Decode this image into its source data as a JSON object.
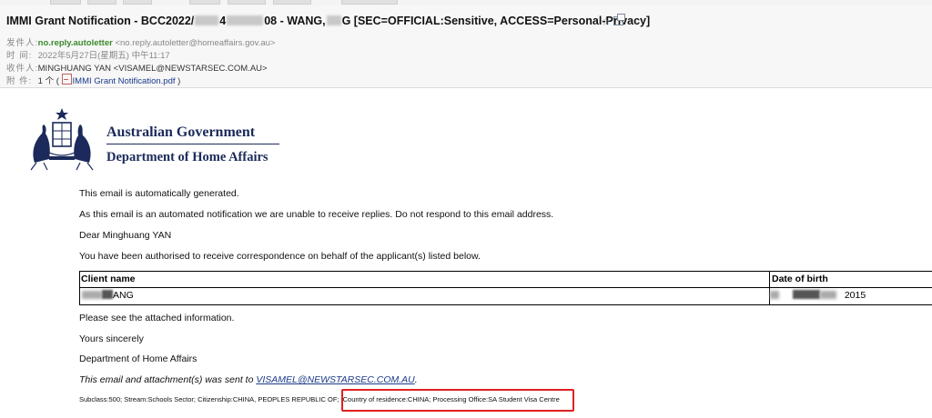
{
  "email": {
    "subject_start": "IMMI Grant Notification - BCC2022/",
    "subject_mid": "4",
    "subject_ref_end": "08 - WANG,",
    "subject_end": "G [SEC=OFFICIAL:Sensitive, ACCESS=Personal-Privacy]",
    "from_label": "发件人:",
    "from_name": "no.reply.autoletter",
    "from_address": "<no.reply.autoletter@homeaffairs.gov.au>",
    "time_label": "时 间:",
    "time_value": "2022年5月27日(星期五) 中午11:17",
    "to_label": "收件人:",
    "to_value": "MINGHUANG YAN <VISAMEL@NEWSTARSEC.COM.AU>",
    "attach_label": "附 件:",
    "attach_count_prefix": "1 个 (",
    "attach_file": "IMMI Grant Notification.pdf",
    "attach_count_suffix": ")"
  },
  "letterhead": {
    "gov_name": "Australian Government",
    "dept_name": "Department of Home Affairs"
  },
  "body": {
    "auto_generated": "This email is automatically generated.",
    "no_reply": "As this email is an automated notification we are unable to receive replies. Do not respond to this email address.",
    "salutation": "Dear Minghuang YAN",
    "authorised": "You have been authorised to receive correspondence on behalf of the applicant(s) listed below.",
    "see_attached": "Please see the attached information.",
    "closing": "Yours sincerely",
    "signature": "Department of Home Affairs",
    "sent_to_prefix": "This email and attachment(s) was sent to ",
    "sent_to_email": "VISAMEL@NEWSTARSEC.COM.AU",
    "sent_to_suffix": "."
  },
  "table": {
    "headers": [
      "Client name",
      "Date of birth"
    ],
    "client_name_visible": "ANG",
    "dob_visible": "2015"
  },
  "footer": {
    "details_left": "Subclass:500; Stream:Schools Sector; Citizenship:CHINA, PEOPLES REPUBLIC OF;",
    "details_right": "Country of residence:CHINA; Processing Office:SA Student Visa Centre"
  },
  "colors": {
    "highlight": "#e02020",
    "brand_navy": "#1b2a5a",
    "sender_green": "#3a8a2a"
  }
}
